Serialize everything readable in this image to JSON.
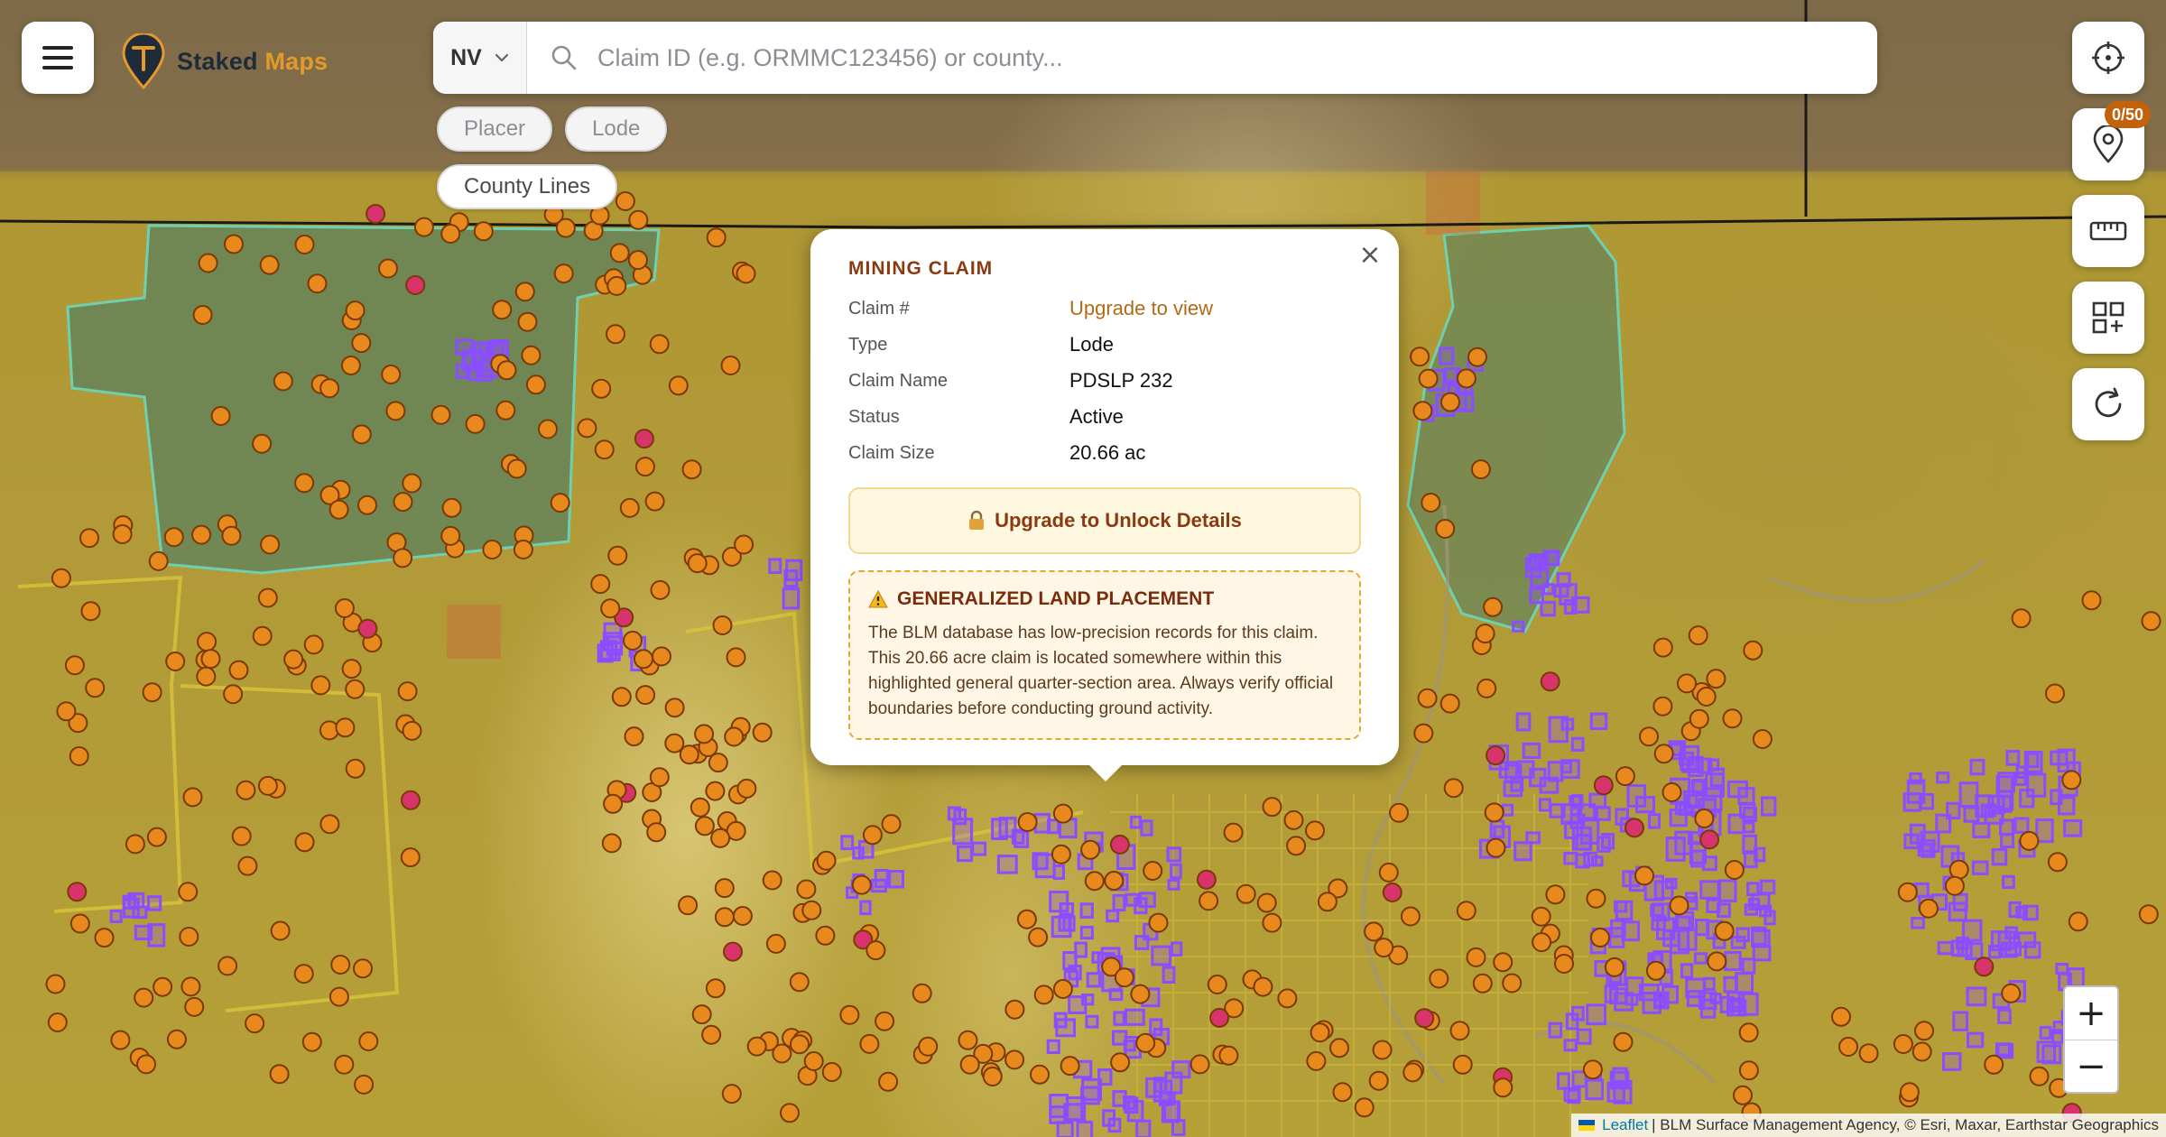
{
  "app": {
    "name_part1": "Staked",
    "name_part2": "Maps"
  },
  "search": {
    "state": "NV",
    "placeholder": "Claim ID (e.g. ORMMC123456) or county..."
  },
  "filters": [
    {
      "label": "Placer",
      "active": false
    },
    {
      "label": "Lode",
      "active": false
    },
    {
      "label": "County Lines",
      "active": true
    }
  ],
  "right_controls": {
    "saved_count": "0/50",
    "icons": [
      "crosshair-icon",
      "map-pin-icon",
      "ruler-icon",
      "grid-icon",
      "refresh-icon"
    ]
  },
  "popup": {
    "title": "MINING CLAIM",
    "rows": [
      {
        "key": "Claim #",
        "value": "Upgrade to view",
        "link": true
      },
      {
        "key": "Type",
        "value": "Lode"
      },
      {
        "key": "Claim Name",
        "value": "PDSLP 232"
      },
      {
        "key": "Status",
        "value": "Active"
      },
      {
        "key": "Claim Size",
        "value": "20.66 ac"
      }
    ],
    "unlock_label": "Upgrade to Unlock Details",
    "warning_title": "GENERALIZED LAND PLACEMENT",
    "warning_text": "The BLM database has low-precision records for this claim. This 20.66 acre claim is located somewhere within this highlighted general quarter-section area. Always verify official boundaries before conducting ground activity."
  },
  "zoom": {
    "in": "+",
    "out": "−"
  },
  "attribution": {
    "leaflet": "Leaflet",
    "sources": "| BLM Surface Management Agency, © Esri, Maxar, Earthstar Geographics"
  },
  "colors": {
    "accent": "#e39a2a",
    "claim_marker": "#e8891e",
    "claim_marker_pink": "#d8336b",
    "claim_parcel": "#8a4dff",
    "popup_title": "#8b3a10"
  }
}
